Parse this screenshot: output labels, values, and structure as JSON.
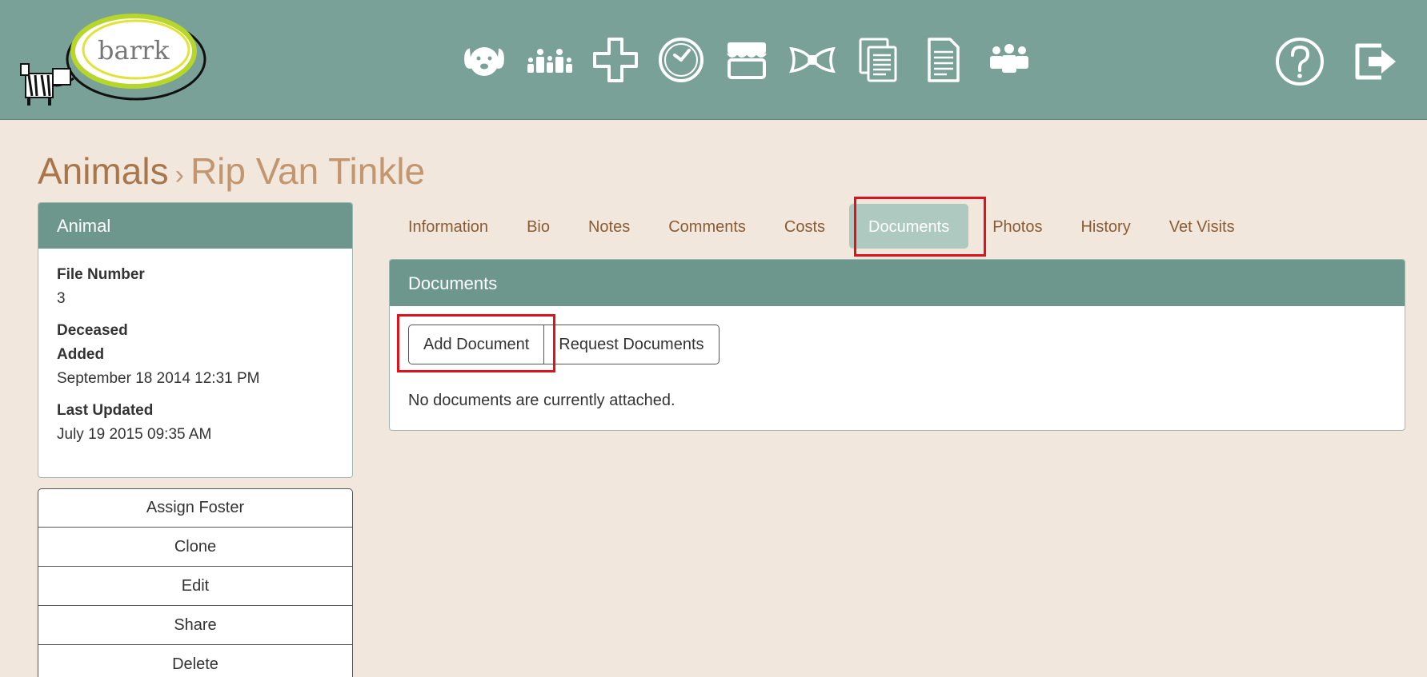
{
  "header": {
    "logo_text": "barrk",
    "nav_icons": [
      "dog-icon",
      "family-icon",
      "medical-cross-icon",
      "clock-icon",
      "store-icon",
      "bowtie-icon",
      "documents-stack-icon",
      "document-icon",
      "people-group-icon"
    ],
    "right_icons": [
      "help-icon",
      "logout-icon"
    ]
  },
  "breadcrumb": {
    "root": "Animals",
    "separator": "›",
    "current": "Rip Van Tinkle"
  },
  "sidebar": {
    "title": "Animal",
    "fields": [
      {
        "label": "File Number",
        "value": "3"
      },
      {
        "label": "Deceased",
        "value": ""
      },
      {
        "label": "Added",
        "value": "September 18 2014 12:31 PM"
      },
      {
        "label": "Last Updated",
        "value": "July 19 2015 09:35 AM"
      }
    ],
    "actions": [
      "Assign Foster",
      "Clone",
      "Edit",
      "Share",
      "Delete"
    ]
  },
  "tabs": [
    {
      "label": "Information",
      "active": false
    },
    {
      "label": "Bio",
      "active": false
    },
    {
      "label": "Notes",
      "active": false
    },
    {
      "label": "Comments",
      "active": false
    },
    {
      "label": "Costs",
      "active": false
    },
    {
      "label": "Documents",
      "active": true
    },
    {
      "label": "Photos",
      "active": false
    },
    {
      "label": "History",
      "active": false
    },
    {
      "label": "Vet Visits",
      "active": false
    }
  ],
  "documents": {
    "title": "Documents",
    "add_button": "Add Document",
    "request_button": "Request Documents",
    "empty_message": "No documents are currently attached."
  },
  "colors": {
    "header_bg": "#7aa197",
    "page_bg": "#f1e7dc",
    "panel_head": "#6d978d",
    "tab_text": "#8a5c33",
    "highlight": "#e0111b"
  }
}
